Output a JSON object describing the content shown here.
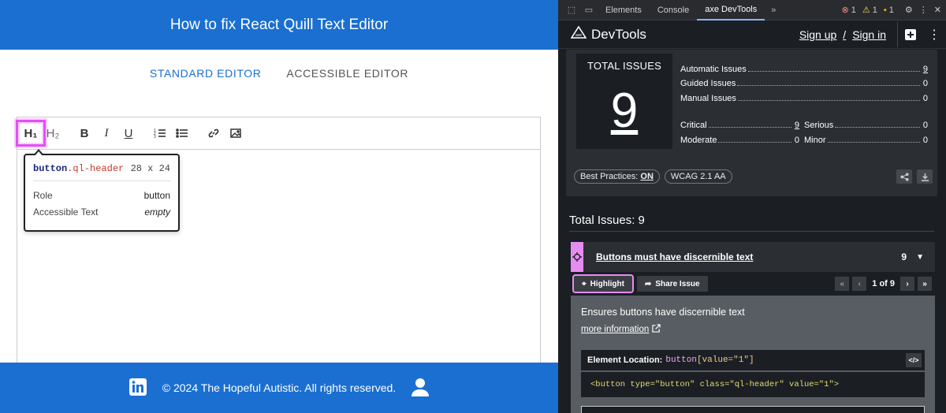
{
  "page": {
    "title": "How to fix React Quill Text Editor",
    "tabs": [
      {
        "label": "STANDARD EDITOR"
      },
      {
        "label": "ACCESSIBLE EDITOR"
      }
    ],
    "footer_text": "© 2024 The Hopeful Autistic. All rights reserved.",
    "accent": "#1a6fd1"
  },
  "toolbar": {
    "h1": "H₁",
    "h2": "H₂",
    "bold": "B",
    "italic": "I",
    "underline": "U"
  },
  "tooltip": {
    "tag": "button",
    "cls": ".ql-header",
    "size": "28 x 24",
    "role_label": "Role",
    "role_value": "button",
    "text_label": "Accessible Text",
    "text_value": "empty"
  },
  "devtools": {
    "tabs": [
      {
        "label": "Elements"
      },
      {
        "label": "Console"
      },
      {
        "label": "axe DevTools"
      }
    ],
    "errors": "1",
    "warnings": "1",
    "issues": "1",
    "brand": "DevTools",
    "sign_up": "Sign up",
    "slash": "/",
    "sign_in": "Sign in"
  },
  "summary": {
    "total_label": "TOTAL ISSUES",
    "total": "9",
    "automatic_label": "Automatic Issues",
    "automatic": "9",
    "guided_label": "Guided Issues",
    "guided": "0",
    "manual_label": "Manual Issues",
    "manual": "0",
    "critical_label": "Critical",
    "critical": "9",
    "serious_label": "Serious",
    "serious": "0",
    "moderate_label": "Moderate",
    "moderate": "0",
    "minor_label": "Minor",
    "minor": "0",
    "best_practices": "Best Practices:",
    "best_practices_state": "ON",
    "standard": "WCAG 2.1 AA"
  },
  "issues": {
    "heading": "Total Issues: 9",
    "rule_title": "Buttons must have discernible text",
    "count": "9",
    "highlight": "Highlight",
    "share": "Share Issue",
    "pager": "1 of 9",
    "description": "Ensures buttons have discernible text",
    "more_info": "more information",
    "location_label": "Element Location:",
    "location_tag": "button",
    "location_attr": "[value=\"1\"]",
    "source": "<button type=\"button\" class=\"ql-header\" value=\"1\">"
  }
}
